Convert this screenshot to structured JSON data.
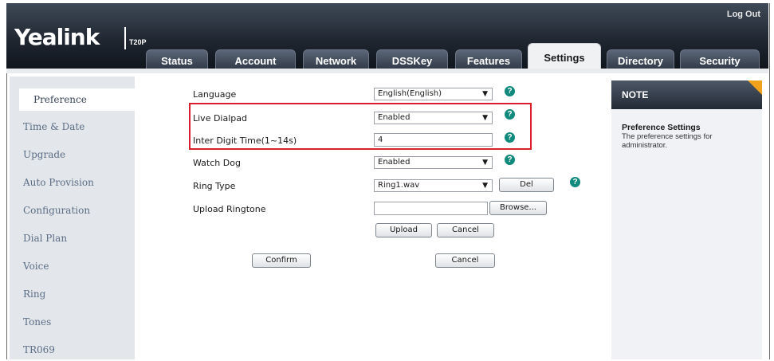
{
  "header": {
    "logo": "Yealink",
    "model": "T20P",
    "logout": "Log Out"
  },
  "tabs": [
    "Status",
    "Account",
    "Network",
    "DSSKey",
    "Features",
    "Settings",
    "Directory",
    "Security"
  ],
  "sidebar": {
    "items": [
      "Preference",
      "Time & Date",
      "Upgrade",
      "Auto Provision",
      "Configuration",
      "Dial Plan",
      "Voice",
      "Ring",
      "Tones",
      "TR069"
    ]
  },
  "form": {
    "language": {
      "label": "Language",
      "value": "English(English)"
    },
    "live_dialpad": {
      "label": "Live Dialpad",
      "value": "Enabled"
    },
    "inter_digit": {
      "label": "Inter Digit Time(1~14s)",
      "value": "4"
    },
    "watch_dog": {
      "label": "Watch Dog",
      "value": "Enabled"
    },
    "ring_type": {
      "label": "Ring Type",
      "value": "Ring1.wav",
      "del": "Del"
    },
    "upload_ringtone": {
      "label": "Upload Ringtone",
      "value": "",
      "browse": "Browse...",
      "upload": "Upload",
      "cancel": "Cancel"
    },
    "confirm": "Confirm",
    "cancel": "Cancel"
  },
  "note": {
    "heading": "NOTE",
    "title": "Preference Settings",
    "text": "The preference settings for administrator."
  },
  "colors": {
    "accent_red": "#d8202a",
    "help_teal": "#0f8a7c",
    "note_corner": "#f0a21a"
  }
}
